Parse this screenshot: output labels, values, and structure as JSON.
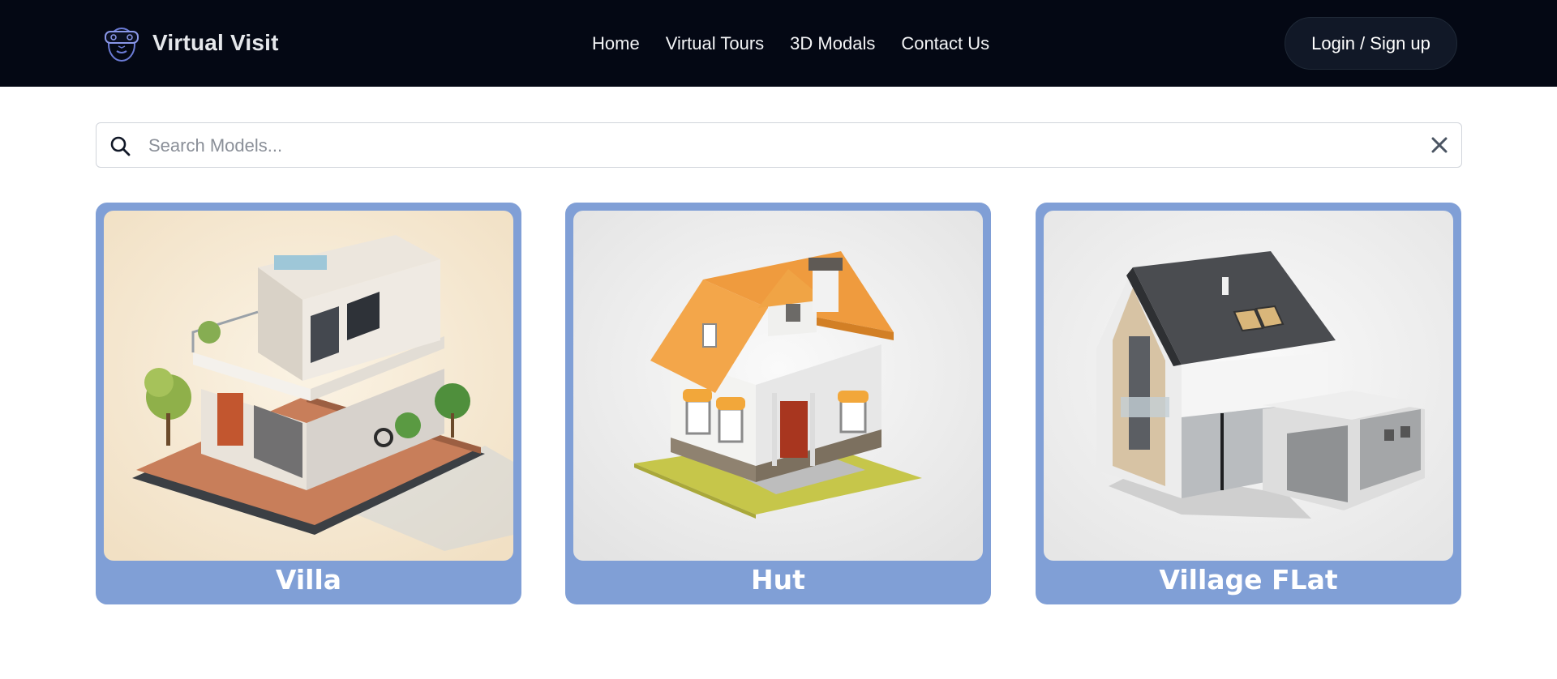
{
  "brand": {
    "name": "Virtual Visit",
    "logo_icon": "vr-headset-face-icon"
  },
  "nav": {
    "links": [
      {
        "label": "Home"
      },
      {
        "label": "Virtual Tours"
      },
      {
        "label": "3D Modals"
      },
      {
        "label": "Contact Us"
      }
    ],
    "login_label": "Login / Sign up"
  },
  "search": {
    "placeholder": "Search Models...",
    "value": "",
    "icon": "search-icon",
    "clear_icon": "close-icon"
  },
  "models": [
    {
      "title": "Villa",
      "image": "modern-villa-isometric-render"
    },
    {
      "title": "Hut",
      "image": "cartoon-cottage-render"
    },
    {
      "title": "Village FLat",
      "image": "gabled-house-with-garage-render"
    }
  ],
  "colors": {
    "navbar_bg": "#040814",
    "card_bg": "#809fd6",
    "login_bg": "#111827"
  }
}
